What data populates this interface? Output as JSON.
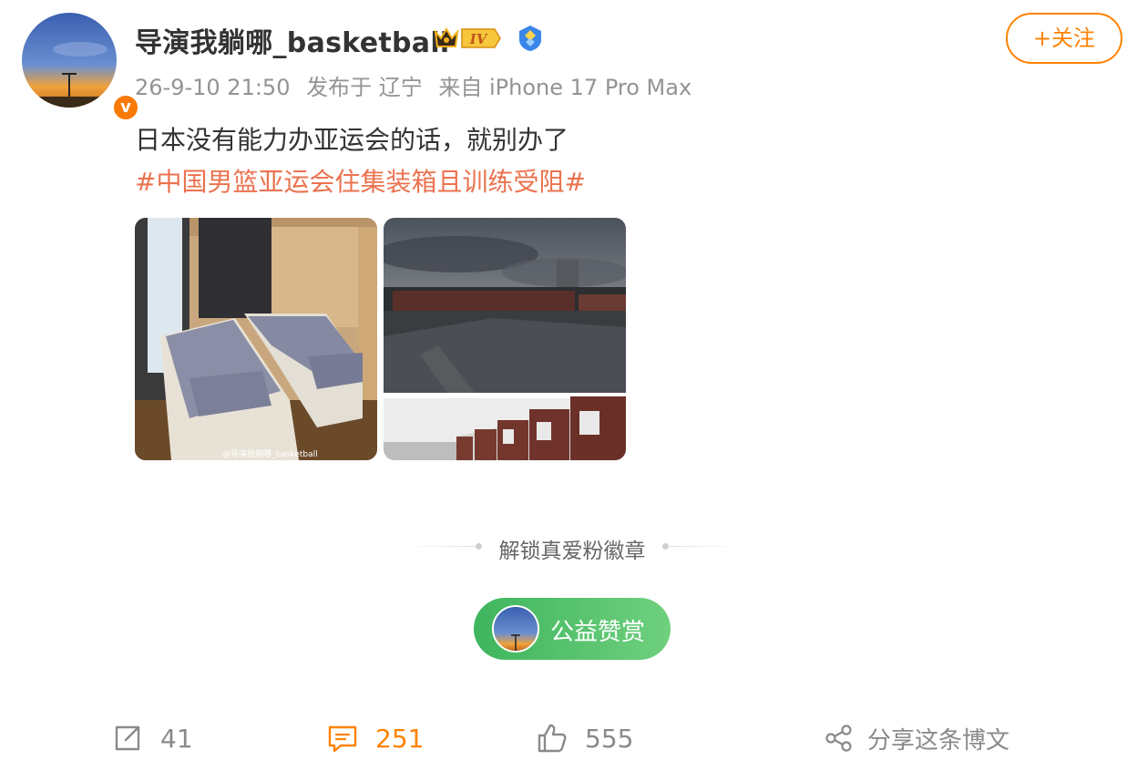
{
  "post": {
    "author": {
      "name": "导演我躺哪_basketball",
      "level_badge": "IV",
      "avatar_icon": "sunset-avatar",
      "verified_icon": "v-badge-icon"
    },
    "follow_label": "+关注",
    "meta": {
      "time": "26-9-10 21:50",
      "location": "发布于 辽宁",
      "source": "来自 iPhone 17 Pro Max"
    },
    "text": "日本没有能力办亚运会的话，就别办了",
    "hashtag": "#中国男篮亚运会住集装箱且训练受阻#",
    "images": [
      {
        "desc_icon": "container-bedroom-photo",
        "watermark": "@导演我躺哪_basketball"
      },
      {
        "desc_icon": "container-village-photo"
      }
    ]
  },
  "unlock_label": "解锁真爱粉徽章",
  "donate_label": "公益赞赏",
  "actions": {
    "repost_count": "41",
    "comment_count": "251",
    "like_count": "555",
    "share_label": "分享这条博文"
  },
  "colors": {
    "accent": "#ff8200",
    "hashtag": "#eb7350",
    "donate_green": "#3fb55e"
  }
}
